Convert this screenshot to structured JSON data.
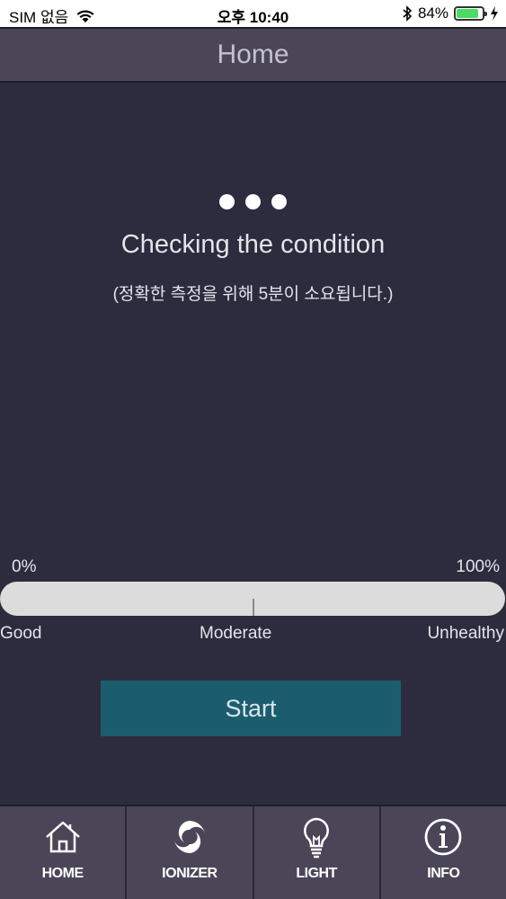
{
  "status_bar": {
    "carrier": "SIM 없음",
    "time": "오후 10:40",
    "battery_percent": "84%",
    "battery_level": 0.84
  },
  "header": {
    "title": "Home"
  },
  "status": {
    "title": "Checking the condition",
    "subtitle": "(정확한 측정을 위해 5분이 소요됩니다.)"
  },
  "gauge": {
    "min_label": "0%",
    "max_label": "100%",
    "good_label": "Good",
    "moderate_label": "Moderate",
    "unhealthy_label": "Unhealthy",
    "value_percent": 50
  },
  "start_button": {
    "label": "Start"
  },
  "tabs": [
    {
      "label": "HOME",
      "icon": "home-icon"
    },
    {
      "label": "IONIZER",
      "icon": "ionizer-icon"
    },
    {
      "label": "LIGHT",
      "icon": "lightbulb-icon"
    },
    {
      "label": "INFO",
      "icon": "info-icon"
    }
  ],
  "colors": {
    "background": "#2c2c3e",
    "bar": "#4a4658",
    "accent": "#1b5d6e",
    "battery": "#4cd964"
  }
}
